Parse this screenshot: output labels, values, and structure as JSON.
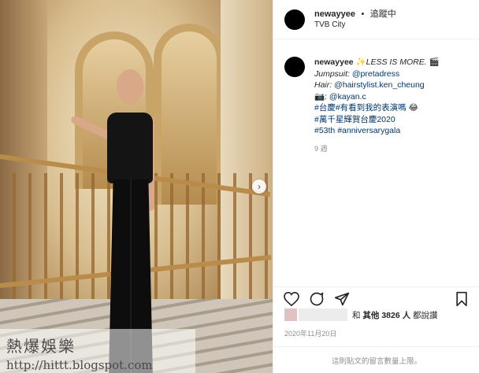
{
  "post": {
    "username": "newayyee",
    "follow_status": "追蹤中",
    "separator": "•",
    "location": "TVB City"
  },
  "caption": {
    "username": "newayyee",
    "line1_emoji": "✨",
    "line1_text": "LESS IS MORE.",
    "line1_emoji2": "🎬",
    "jumpsuit_label": "Jumpsuit:",
    "jumpsuit_value": "@pretadress",
    "hair_label": "Hair:",
    "hair_value": "@hairstylist.ken_cheung",
    "camera_emoji": "📷:",
    "camera_value": "@kayan.c",
    "tags": [
      "#台慶",
      "#有看到我的表演嗎",
      "#萬千星輝賀台慶2020",
      "#53th",
      "#anniversarygala"
    ],
    "tag2_emoji": "😂",
    "time_ago": "9 週"
  },
  "likes": {
    "prefix": "和",
    "others": "其他 3826 人",
    "suffix": "都說讚"
  },
  "date": "2020年11月20日",
  "comments_off": "這則貼文的留言數量上限。",
  "watermark": {
    "title": "熱爆娛樂",
    "url": "http://hittt.blogspot.com"
  },
  "icons": {
    "next": "chevron-right-icon",
    "like": "heart-icon",
    "comment": "comment-icon",
    "share": "send-icon",
    "save": "bookmark-icon"
  }
}
